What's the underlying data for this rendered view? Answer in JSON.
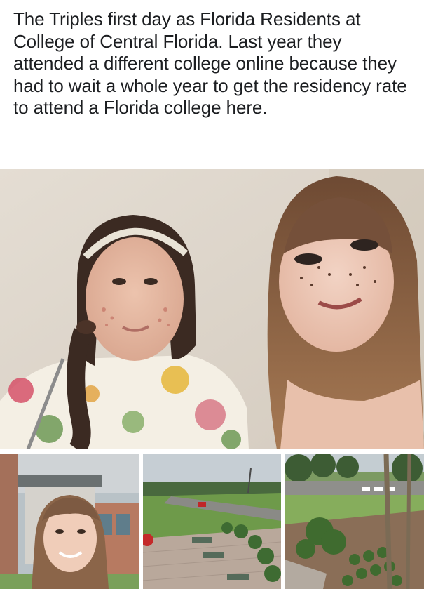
{
  "post": {
    "text": "The Triples first day as Florida Residents at College of Central Florida. Last year they attended a different college online because they had to wait a whole year to get the residency rate to attend a Florida college here."
  },
  "photos": {
    "main": {
      "subject": "selfie-two-young-women"
    },
    "thumbnails": [
      {
        "subject": "selfie-outside-campus-building"
      },
      {
        "subject": "campus-courtyard-view-from-above"
      },
      {
        "subject": "campus-garden-palm-trees"
      }
    ]
  }
}
